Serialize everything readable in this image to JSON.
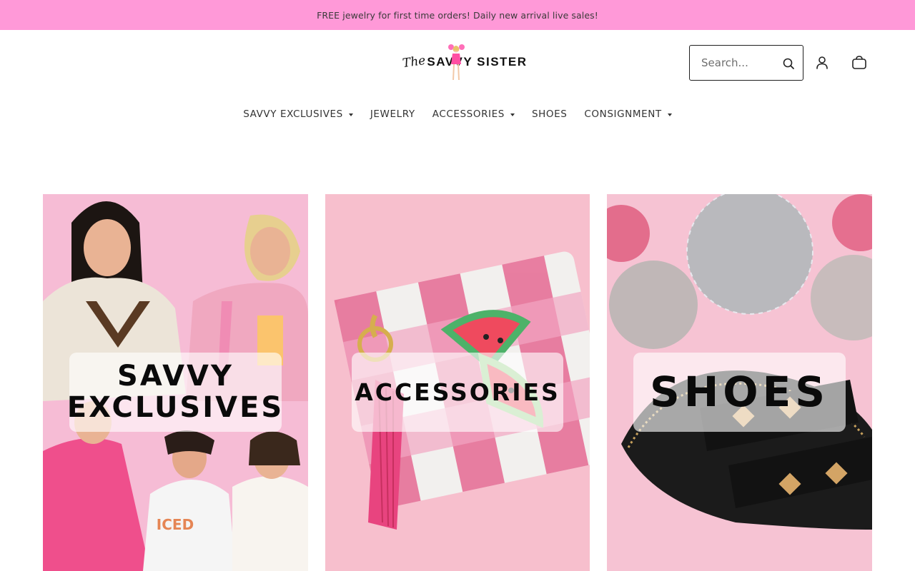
{
  "announcement": {
    "text": "FREE jewelry for first time orders! Daily new arrival live sales!",
    "bg_color": "#ff99d8"
  },
  "header": {
    "logo": {
      "prefix": "The",
      "name": "SAVVY SISTER"
    },
    "search": {
      "placeholder": "Search...",
      "icon": "search-icon"
    },
    "account_icon": "user-icon",
    "cart_icon": "bag-icon"
  },
  "nav": {
    "items": [
      {
        "label": "SAVVY EXCLUSIVES",
        "has_dropdown": true
      },
      {
        "label": "JEWELRY",
        "has_dropdown": false
      },
      {
        "label": "ACCESSORIES",
        "has_dropdown": true
      },
      {
        "label": "SHOES",
        "has_dropdown": false
      },
      {
        "label": "CONSIGNMENT",
        "has_dropdown": true
      }
    ]
  },
  "collections": [
    {
      "label_line1": "SAVVY",
      "label_line2": "EXCLUSIVES",
      "bg_color": "#f7b8d3"
    },
    {
      "label_line1": "ACCESSORIES",
      "bg_color": "#f6bccb"
    },
    {
      "label_line1": "SHOES",
      "bg_color": "#f7c2d2"
    }
  ]
}
